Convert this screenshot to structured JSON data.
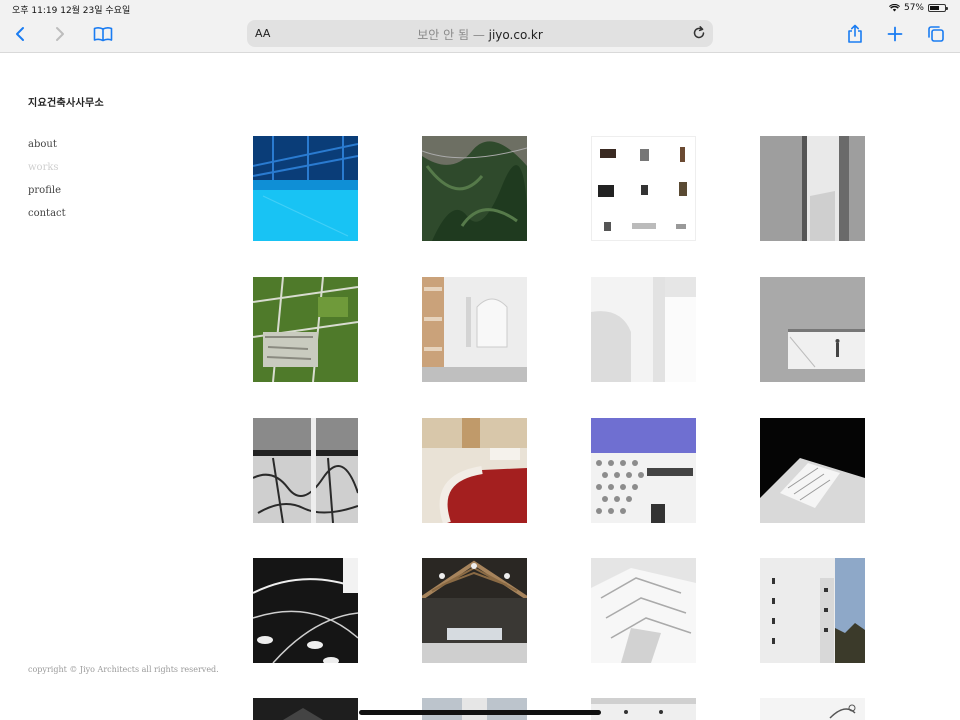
{
  "status_bar": {
    "time_date": "오후 11:19  12월 23일 수요일",
    "battery": "57%",
    "battery_level": 0.57
  },
  "browser": {
    "aa_label": "AA",
    "url_prefix": "보안 안 됨 — ",
    "url_host": "jiyo.co.kr",
    "accent_color": "#1a7cf2"
  },
  "site": {
    "title": "지요건축사사무소",
    "nav": [
      {
        "label": "about"
      },
      {
        "label": "works"
      },
      {
        "label": "profile"
      },
      {
        "label": "contact"
      }
    ],
    "copyright": "copyright © Jiyo Architects all rights reserved."
  },
  "gallery": [
    {
      "name": "blue-interior"
    },
    {
      "name": "aerial-mountain"
    },
    {
      "name": "object-collection"
    },
    {
      "name": "grey-wall-opening"
    },
    {
      "name": "aerial-farmland"
    },
    {
      "name": "white-corridor"
    },
    {
      "name": "white-curved-interior"
    },
    {
      "name": "grey-window-figure"
    },
    {
      "name": "cracked-concrete"
    },
    {
      "name": "red-floor-lounge"
    },
    {
      "name": "perforated-facade"
    },
    {
      "name": "white-model-dark"
    },
    {
      "name": "road-cars-model"
    },
    {
      "name": "timber-roof-hall"
    },
    {
      "name": "white-terrain-model"
    },
    {
      "name": "white-tower-building"
    },
    {
      "name": "row5-dark"
    },
    {
      "name": "row5-sky"
    },
    {
      "name": "row5-interior"
    },
    {
      "name": "row5-sketch"
    }
  ]
}
